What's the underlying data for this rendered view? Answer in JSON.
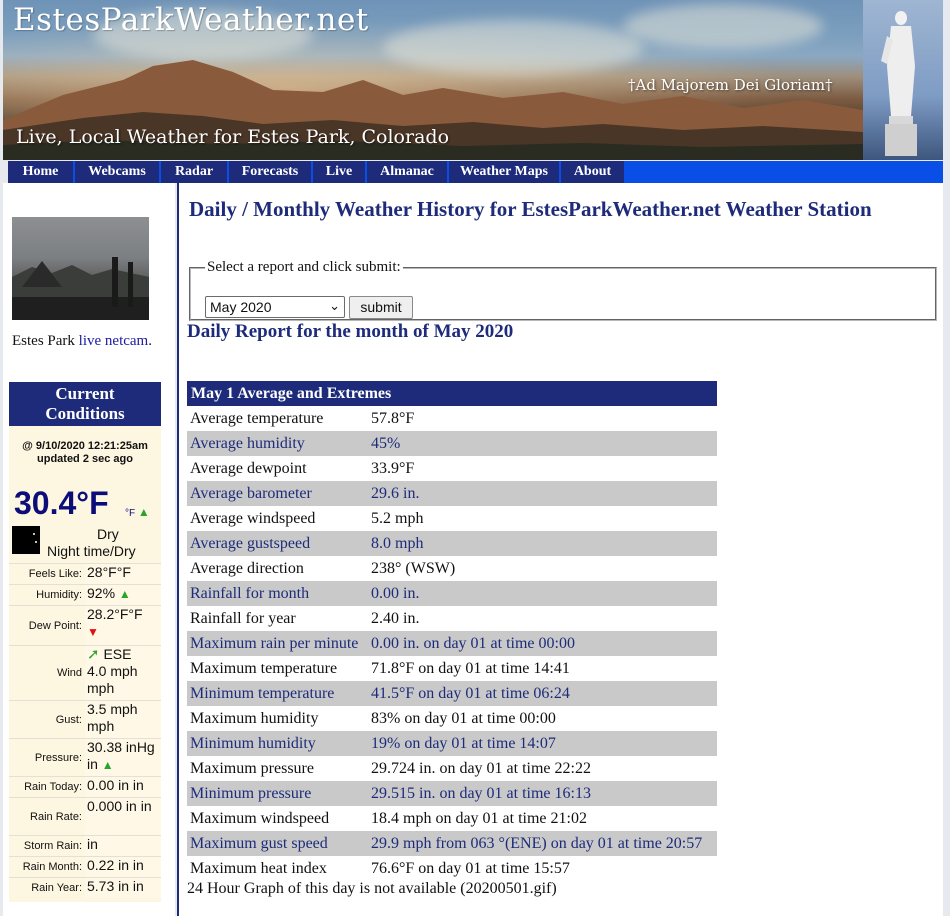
{
  "header": {
    "site_title": "EstesParkWeather.net",
    "motto": "†Ad Majorem Dei Gloriam†",
    "tagline": "Live, Local Weather for Estes Park, Colorado"
  },
  "nav": [
    "Home",
    "Webcams",
    "Radar",
    "Forecasts",
    "Live",
    "Almanac",
    "Weather Maps",
    "About"
  ],
  "sidebar": {
    "webcam_caption_prefix": "Estes Park ",
    "webcam_link": "live netcam",
    "webcam_caption_suffix": ".",
    "current_conditions": {
      "title_line1": "Current",
      "title_line2": "Conditions",
      "timestamp": "@ 9/10/2020 12:21:25am",
      "updated": "updated 2 sec ago",
      "temperature": "30.4°F",
      "temp_unit": "°F",
      "condition_line1": "Dry",
      "condition_line2": "Night time/Dry",
      "rows": [
        {
          "label": "Feels Like:",
          "value": "28°F°F"
        },
        {
          "label": "Humidity:",
          "value": "92%"
        },
        {
          "label": "Dew Point:",
          "value": "28.2°F°F"
        },
        {
          "label": "Wind",
          "value": "ESE 4.0 mph mph"
        },
        {
          "label": "Gust:",
          "value": "3.5 mph mph"
        },
        {
          "label": "Pressure:",
          "value": "30.38 inHg in"
        },
        {
          "label": "Rain Today:",
          "value": "0.00 in in"
        },
        {
          "label": "Rain Rate:",
          "value": "0.000 in in"
        },
        {
          "label": "Storm Rain:",
          "value": "in"
        },
        {
          "label": "Rain Month:",
          "value": "0.22 in in"
        },
        {
          "label": "Rain Year:",
          "value": "5.73 in in"
        }
      ],
      "wind_dir": "ESE",
      "wind_speed": "4.0 mph mph",
      "gust": "3.5 mph mph",
      "pressure": "30.38 inHg in"
    }
  },
  "main": {
    "page_title": "Daily / Monthly Weather History for EstesParkWeather.net Weather Station",
    "form_legend": "Select a report and click submit:",
    "selected_report": "May 2020",
    "submit_label": "submit",
    "report_title": "Daily Report for the month of May 2020",
    "table_header": "May 1 Average and Extremes",
    "rows": [
      {
        "label": "Average temperature",
        "value": "57.8°F"
      },
      {
        "label": "Average humidity",
        "value": "45%"
      },
      {
        "label": "Average dewpoint",
        "value": "33.9°F"
      },
      {
        "label": "Average barometer",
        "value": "29.6 in."
      },
      {
        "label": "Average windspeed",
        "value": "5.2 mph"
      },
      {
        "label": "Average gustspeed",
        "value": "8.0 mph"
      },
      {
        "label": "Average direction",
        "value": "238° (WSW)"
      },
      {
        "label": "Rainfall for month",
        "value": "0.00 in."
      },
      {
        "label": "Rainfall for year",
        "value": "2.40 in."
      },
      {
        "label": "Maximum rain per minute",
        "value": "0.00 in. on day 01 at time 00:00"
      },
      {
        "label": "Maximum temperature",
        "value": "71.8°F on day 01 at time 14:41"
      },
      {
        "label": "Minimum temperature",
        "value": "41.5°F on day 01 at time 06:24"
      },
      {
        "label": "Maximum humidity",
        "value": "83% on day 01 at time 00:00"
      },
      {
        "label": "Minimum humidity",
        "value": "19% on day 01 at time 14:07"
      },
      {
        "label": "Maximum pressure",
        "value": "29.724 in. on day 01 at time 22:22"
      },
      {
        "label": "Minimum pressure",
        "value": "29.515 in. on day 01 at time 16:13"
      },
      {
        "label": "Maximum windspeed",
        "value": "18.4 mph on day 01 at time 21:02"
      },
      {
        "label": "Maximum gust speed",
        "value": "29.9 mph from 063 °(ENE) on day 01 at time 20:57"
      },
      {
        "label": "Maximum heat index",
        "value": "76.6°F on day 01 at time 15:57"
      }
    ],
    "graph_note": "24 Hour Graph of this day is not available (20200501.gif)"
  },
  "colors": {
    "navy": "#1d2b7a",
    "nav_bar": "#0a4ee8",
    "alt_row": "#c9c9c9",
    "panel_bg": "#fdf6e1"
  }
}
